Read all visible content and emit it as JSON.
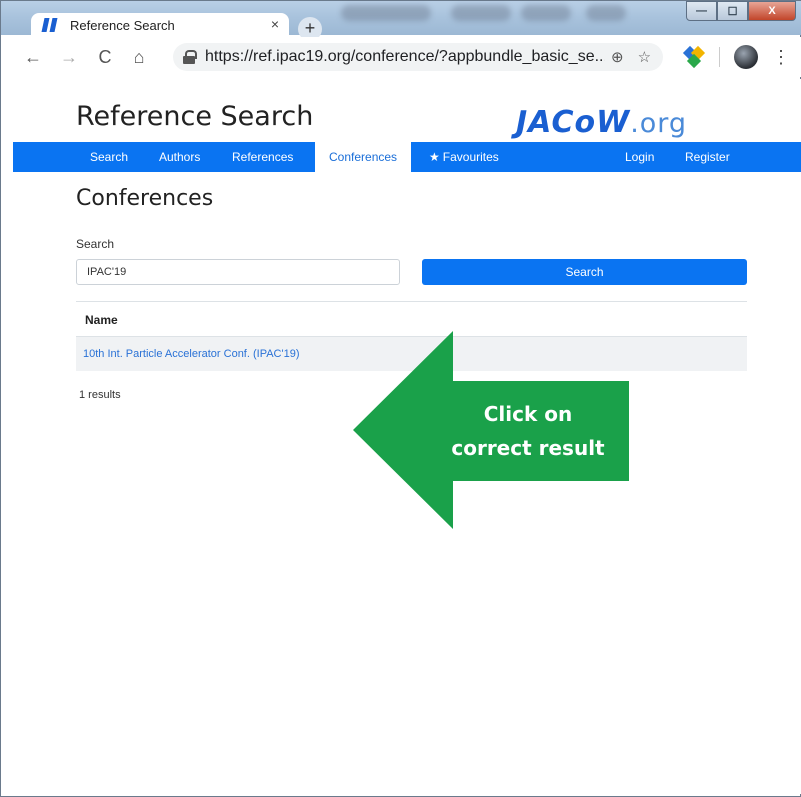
{
  "browser": {
    "tab_title": "Reference Search",
    "tab_close": "×",
    "new_tab": "+",
    "url": "https://ref.ipac19.org/conference/?appbundle_basic_se...",
    "window_controls": {
      "minimize": "—",
      "maximize": "☐",
      "close": "X"
    },
    "nav": {
      "back": "←",
      "forward": "→",
      "reload": "C",
      "home": "⌂"
    },
    "zoom_icon": "⊕",
    "bookmark_icon": "☆",
    "menu_icon": "⋮"
  },
  "site": {
    "title": "Reference Search",
    "logo_main": "JACoW",
    "logo_suffix": ".org"
  },
  "nav": {
    "items": [
      "Search",
      "Authors",
      "References",
      "Conferences",
      "Favourites",
      "Login",
      "Register"
    ],
    "active": "Conferences"
  },
  "main": {
    "heading": "Conferences",
    "search_label": "Search",
    "search_value": "IPAC'19",
    "search_button": "Search",
    "table_header": "Name",
    "rows": [
      "10th Int. Particle Accelerator Conf. (IPAC'19)"
    ],
    "results_text": "1 results"
  },
  "callout": {
    "line1": "Click on",
    "line2": "correct result",
    "color": "#1aa14a"
  },
  "colors": {
    "primary": "#0a74f2",
    "link": "#2a72d6"
  }
}
